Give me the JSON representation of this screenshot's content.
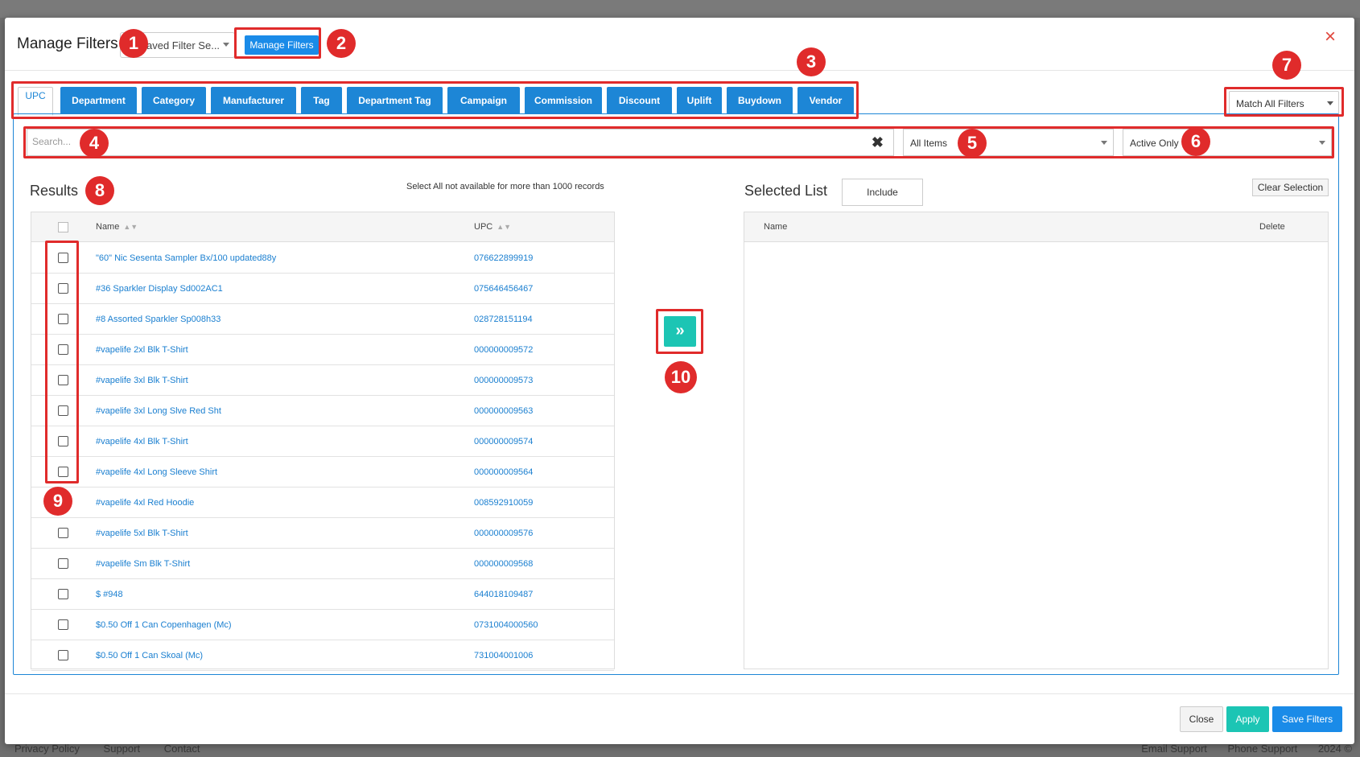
{
  "background": {
    "footer_left": [
      "Privacy Policy",
      "Support",
      "Contact"
    ],
    "footer_right": [
      "Email Support",
      "Phone Support",
      "2024 ©"
    ]
  },
  "modal": {
    "title": "Manage Filters",
    "saved_filter_placeholder": "aved Filter Se...",
    "manage_button": "Manage Filters",
    "close_icon": "×"
  },
  "tabs": [
    {
      "label": "UPC",
      "active": true
    },
    {
      "label": "Department"
    },
    {
      "label": "Category"
    },
    {
      "label": "Manufacturer"
    },
    {
      "label": "Tag"
    },
    {
      "label": "Department Tag"
    },
    {
      "label": "Campaign"
    },
    {
      "label": "Commission"
    },
    {
      "label": "Discount"
    },
    {
      "label": "Uplift"
    },
    {
      "label": "Buydown"
    },
    {
      "label": "Vendor"
    }
  ],
  "match_select": "Match All Filters",
  "search": {
    "placeholder": "Search...",
    "clear_icon": "✖"
  },
  "items_select": "All Items",
  "status_select": "Active Only",
  "results": {
    "title": "Results",
    "note": "Select All not available for more than 1000 records",
    "columns": {
      "name": "Name",
      "upc": "UPC"
    },
    "rows": [
      {
        "name": "\"60\" Nic Sesenta Sampler Bx/100 updated88y",
        "upc": "076622899919"
      },
      {
        "name": "#36 Sparkler Display Sd002AC1",
        "upc": "075646456467"
      },
      {
        "name": "#8 Assorted Sparkler Sp008h33",
        "upc": "028728151194"
      },
      {
        "name": "#vapelife 2xl Blk T-Shirt",
        "upc": "000000009572"
      },
      {
        "name": "#vapelife 3xl Blk T-Shirt",
        "upc": "000000009573"
      },
      {
        "name": "#vapelife 3xl Long Slve Red Sht",
        "upc": "000000009563"
      },
      {
        "name": "#vapelife 4xl Blk T-Shirt",
        "upc": "000000009574"
      },
      {
        "name": "#vapelife 4xl Long Sleeve Shirt",
        "upc": "000000009564"
      },
      {
        "name": "#vapelife 4xl Red Hoodie",
        "upc": "008592910059"
      },
      {
        "name": "#vapelife 5xl Blk T-Shirt",
        "upc": "000000009576"
      },
      {
        "name": "#vapelife Sm Blk T-Shirt",
        "upc": "000000009568"
      },
      {
        "name": "$ #948",
        "upc": "644018109487"
      },
      {
        "name": "$0.50 Off 1 Can Copenhagen (Mc)",
        "upc": "0731004000560"
      },
      {
        "name": "$0.50 Off 1 Can Skoal (Mc)",
        "upc": "731004001006"
      }
    ]
  },
  "move_button_icon": "»",
  "selected": {
    "title": "Selected List",
    "include_label": "Include",
    "clear_label": "Clear Selection",
    "columns": {
      "name": "Name",
      "delete": "Delete"
    }
  },
  "footer": {
    "close": "Close",
    "apply": "Apply",
    "save": "Save Filters"
  },
  "annotations": [
    "1",
    "2",
    "3",
    "4",
    "5",
    "6",
    "7",
    "8",
    "9",
    "10"
  ],
  "colors": {
    "primary": "#1d86d6",
    "teal": "#1cc5b4",
    "annotation_red": "#e02b2b",
    "link": "#1a7fd0"
  }
}
